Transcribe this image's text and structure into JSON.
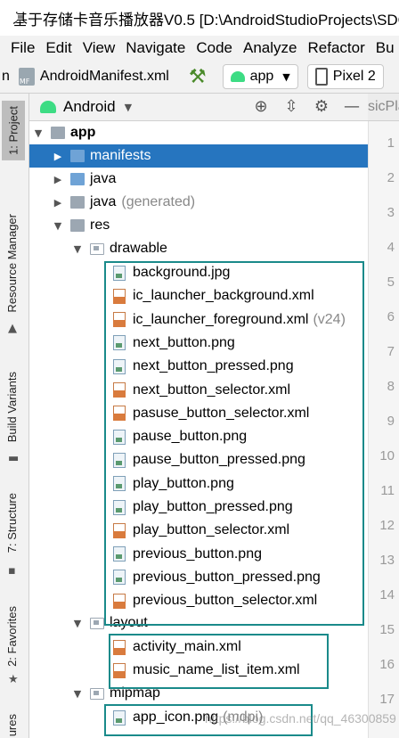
{
  "window": {
    "title": "基于存储卡音乐播放器V0.5 [D:\\AndroidStudioProjects\\SDC"
  },
  "menu": [
    "File",
    "Edit",
    "View",
    "Navigate",
    "Code",
    "Analyze",
    "Refactor",
    "Bu"
  ],
  "toolbar": {
    "leading_text": "n",
    "file_name": "AndroidManifest.xml",
    "run_config": "app",
    "device": "Pixel 2"
  },
  "side_tabs": {
    "project": "1: Project",
    "resource_manager": "Resource Manager",
    "build_variants": "Build Variants",
    "structure": "7: Structure",
    "favorites": "2: Favorites",
    "bottom": "ures"
  },
  "project_panel": {
    "view_selector": "Android"
  },
  "editor_tab": {
    "label": "sicPla"
  },
  "line_numbers": [
    "1",
    "2",
    "3",
    "4",
    "5",
    "6",
    "7",
    "8",
    "9",
    "10",
    "11",
    "12",
    "13",
    "14",
    "15",
    "16",
    "17"
  ],
  "tree": {
    "app": "app",
    "manifests": "manifests",
    "java": "java",
    "java_generated": "java",
    "generated_suffix": "(generated)",
    "res": "res",
    "drawable": "drawable",
    "drawable_files": [
      {
        "name": "background.jpg",
        "kind": "image",
        "qualifier": ""
      },
      {
        "name": "ic_launcher_background.xml",
        "kind": "xml",
        "qualifier": ""
      },
      {
        "name": "ic_launcher_foreground.xml",
        "kind": "xml",
        "qualifier": "(v24)"
      },
      {
        "name": "next_button.png",
        "kind": "image",
        "qualifier": ""
      },
      {
        "name": "next_button_pressed.png",
        "kind": "image",
        "qualifier": ""
      },
      {
        "name": "next_button_selector.xml",
        "kind": "xml",
        "qualifier": ""
      },
      {
        "name": "pasuse_button_selector.xml",
        "kind": "xml",
        "qualifier": ""
      },
      {
        "name": "pause_button.png",
        "kind": "image",
        "qualifier": ""
      },
      {
        "name": "pause_button_pressed.png",
        "kind": "image",
        "qualifier": ""
      },
      {
        "name": "play_button.png",
        "kind": "image",
        "qualifier": ""
      },
      {
        "name": "play_button_pressed.png",
        "kind": "image",
        "qualifier": ""
      },
      {
        "name": "play_button_selector.xml",
        "kind": "xml",
        "qualifier": ""
      },
      {
        "name": "previous_button.png",
        "kind": "image",
        "qualifier": ""
      },
      {
        "name": "previous_button_pressed.png",
        "kind": "image",
        "qualifier": ""
      },
      {
        "name": "previous_button_selector.xml",
        "kind": "xml",
        "qualifier": ""
      }
    ],
    "layout": "layout",
    "layout_files": [
      {
        "name": "activity_main.xml",
        "kind": "xml",
        "qualifier": ""
      },
      {
        "name": "music_name_list_item.xml",
        "kind": "xml",
        "qualifier": ""
      }
    ],
    "mipmap": "mipmap",
    "mipmap_files": [
      {
        "name": "app_icon.png",
        "kind": "image",
        "qualifier": "(mdpi)"
      }
    ]
  },
  "watermark": "https://blog.csdn.net/qq_46300859",
  "colors": {
    "selection": "#2675bf",
    "highlight_box": "#1a8a8a",
    "android_green": "#3ddc84"
  }
}
